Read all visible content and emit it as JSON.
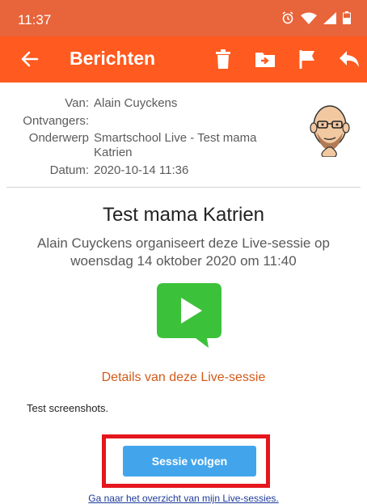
{
  "status_bar": {
    "time": "11:37",
    "icons": [
      "alarm-icon",
      "wifi-icon",
      "signal-icon",
      "battery-icon"
    ]
  },
  "app_bar": {
    "title": "Berichten",
    "actions": [
      "back-arrow-icon",
      "trash-icon",
      "move-to-folder-icon",
      "flag-icon",
      "reply-icon"
    ],
    "color": "#ff5a1f"
  },
  "message_meta": {
    "from_label": "Van:",
    "from_value": "Alain Cuyckens",
    "to_label": "Ontvangers:",
    "to_value": "",
    "subject_label": "Onderwerp",
    "subject_value": "Smartschool Live - Test mama Katrien",
    "date_label": "Datum:",
    "date_value": "2020-10-14 11:36"
  },
  "session": {
    "title": "Test mama Katrien",
    "description": "Alain Cuyckens organiseert deze Live-sessie op woensdag 14 oktober 2020 om 11:40",
    "details_link": "Details van deze Live-sessie",
    "note": "Test screenshots.",
    "follow_button": "Sessie volgen",
    "overview_link": "Ga naar het overzicht van mijn Live-sessies."
  }
}
